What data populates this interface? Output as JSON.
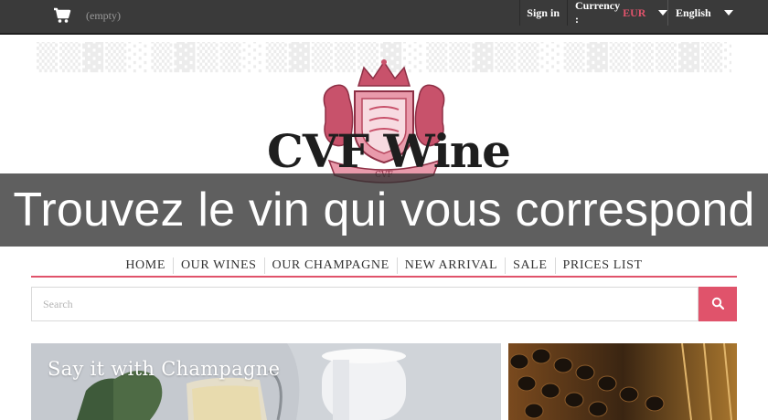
{
  "topbar": {
    "cart_status": "(empty)",
    "sign_in": "Sign in",
    "currency_label": "Currency :",
    "currency_value": "EUR",
    "language": "English"
  },
  "logo": {
    "wordmark": "CVF Wine",
    "crest_banner": "CVF"
  },
  "overlay": {
    "caption": "Trouvez le vin qui vous correspond"
  },
  "nav": {
    "items": [
      "HOME",
      "OUR WINES",
      "OUR CHAMPAGNE",
      "NEW ARRIVAL",
      "SALE",
      "PRICES LIST"
    ]
  },
  "search": {
    "placeholder": "Search"
  },
  "banners": {
    "left_title": "Say it with Champagne"
  },
  "colors": {
    "accent": "#e0536b",
    "topbar": "#3a3a3a",
    "crest": "#c8526b"
  }
}
